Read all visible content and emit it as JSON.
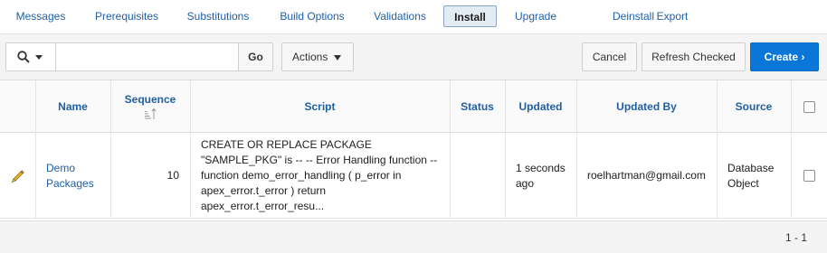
{
  "tabs": [
    {
      "label": "Messages"
    },
    {
      "label": "Prerequisites"
    },
    {
      "label": "Substitutions"
    },
    {
      "label": "Build Options"
    },
    {
      "label": "Validations"
    },
    {
      "label": "Install",
      "active": true
    },
    {
      "label": "Upgrade"
    },
    {
      "label": "Deinstall"
    },
    {
      "label": "Export"
    }
  ],
  "toolbar": {
    "search_value": "",
    "go_label": "Go",
    "actions_label": "Actions",
    "cancel_label": "Cancel",
    "refresh_label": "Refresh Checked",
    "create_label": "Create ›"
  },
  "table": {
    "columns": [
      "Name",
      "Sequence",
      "Script",
      "Status",
      "Updated",
      "Updated By",
      "Source"
    ],
    "rows": [
      {
        "name": "Demo Packages",
        "sequence": "10",
        "script": "CREATE OR REPLACE PACKAGE \"SAMPLE_PKG\" is -- -- Error Handling function -- function demo_error_handling ( p_error in apex_error.t_error ) return apex_error.t_error_resu...",
        "status": "",
        "updated": "1 seconds ago",
        "updated_by": "roelhartman@gmail.com",
        "source": "Database Object",
        "checked": false
      }
    ]
  },
  "pagination": "1 - 1",
  "colors": {
    "link": "#1f5fa3",
    "primary": "#0a76d8",
    "active_tab_bg": "#e3ebf3",
    "edit_icon": "#e8b923"
  },
  "icons": {
    "search": "search-icon",
    "edit": "pencil-icon",
    "sort": "sort-ascending-icon"
  }
}
